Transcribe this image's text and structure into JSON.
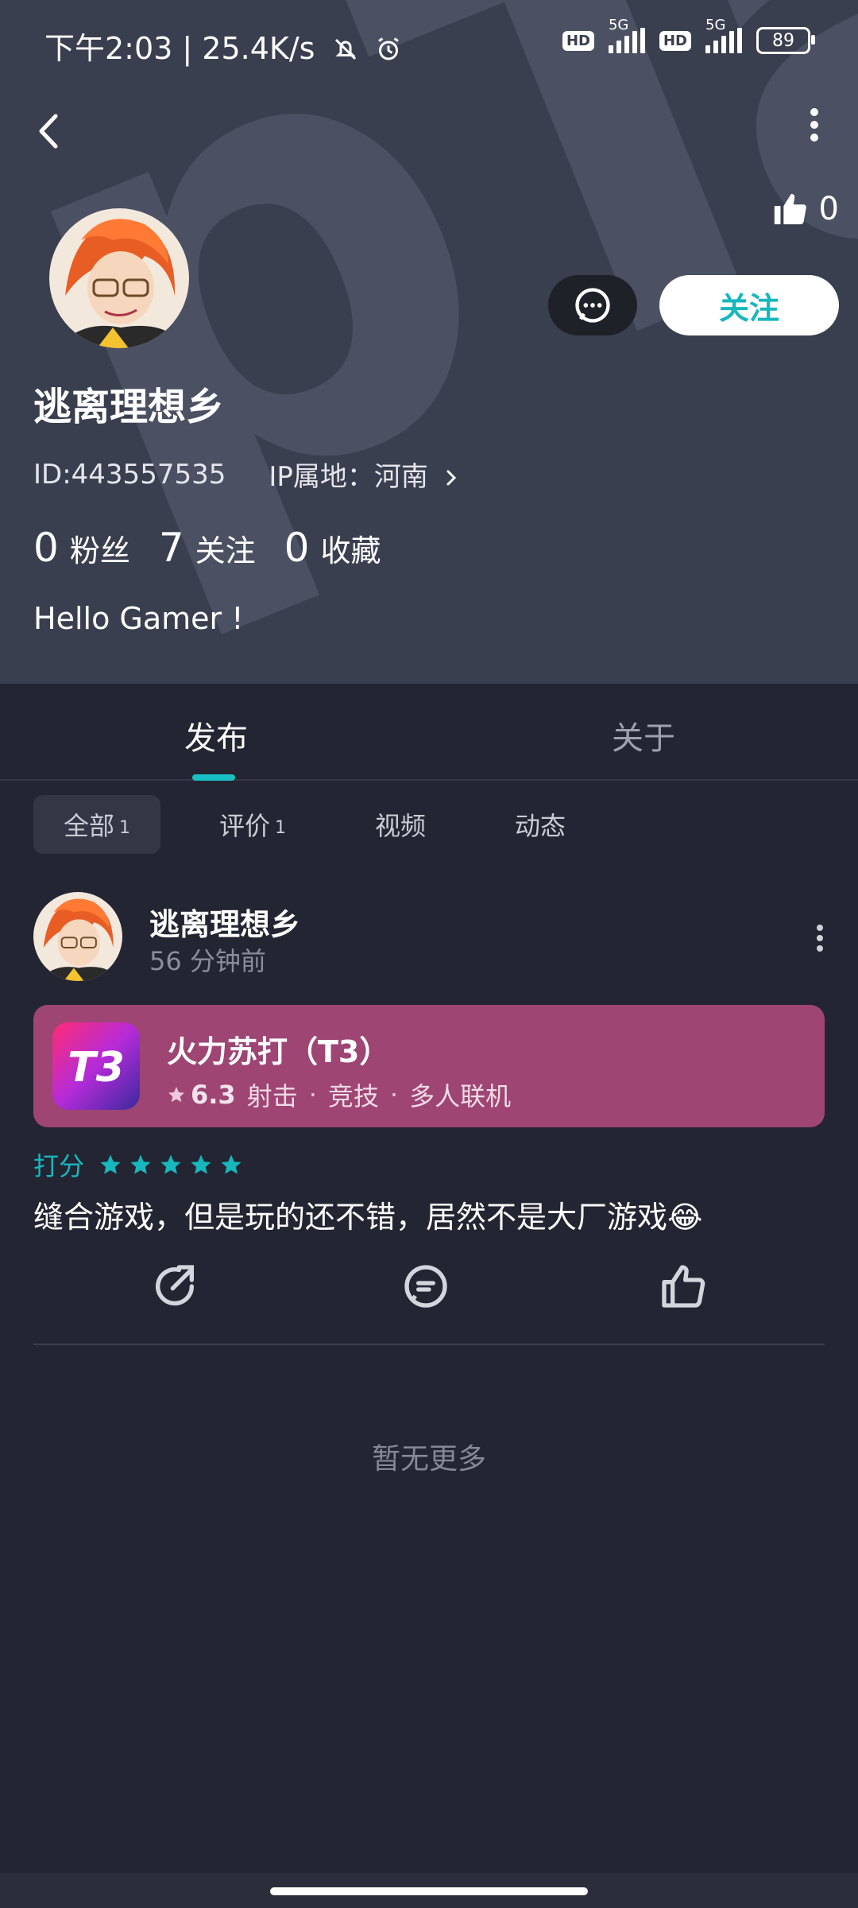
{
  "status_bar": {
    "time": "下午2:03 | 25.4K/s",
    "signal1_label": "5G",
    "signal2_label": "5G",
    "hd_badge": "HD",
    "battery": "89"
  },
  "header": {
    "like_count": "0",
    "message_icon": "chat-bubble-icon",
    "follow_label": "关注",
    "username": "逃离理想乡",
    "user_id": "ID:443557535",
    "ip_location": "IP属地：河南",
    "stats": [
      {
        "num": "0",
        "label": "粉丝"
      },
      {
        "num": "7",
        "label": "关注"
      },
      {
        "num": "0",
        "label": "收藏"
      }
    ],
    "bio": "Hello Gamer !"
  },
  "tabs": {
    "publish": "发布",
    "about": "关于"
  },
  "filters": [
    {
      "label": "全部",
      "count": "1"
    },
    {
      "label": "评价",
      "count": "1"
    },
    {
      "label": "视频",
      "count": ""
    },
    {
      "label": "动态",
      "count": ""
    }
  ],
  "post": {
    "author": "逃离理想乡",
    "time": "56 分钟前",
    "game": {
      "title": "火力苏打（T3）",
      "rating": "6.3",
      "tags": [
        "射击",
        "竞技",
        "多人联机"
      ],
      "icon_text": "T3"
    },
    "score_label": "打分",
    "stars": 5,
    "review_text": "缝合游戏，但是玩的还不错，居然不是大厂游戏😂"
  },
  "no_more": "暂无更多",
  "colors": {
    "accent": "#17b7bd",
    "card": "#9e4574",
    "background": "#232532",
    "header": "#3a3f4f"
  }
}
